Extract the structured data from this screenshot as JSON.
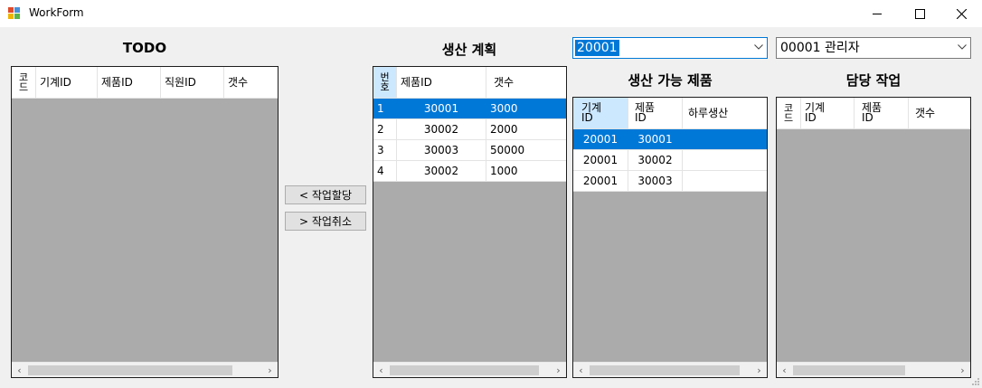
{
  "window": {
    "title": "WorkForm"
  },
  "todo": {
    "heading": "TODO",
    "columns": [
      "코\n드",
      "기계ID",
      "제품ID",
      "직원ID",
      "갯수"
    ]
  },
  "actions": {
    "assign_label": "< 작업할당",
    "cancel_label": "> 작업취소"
  },
  "plan": {
    "heading": "생산 계획",
    "columns": [
      "번\n호",
      "제품ID",
      "갯수"
    ],
    "rows": [
      [
        "1",
        "30001",
        "3000"
      ],
      [
        "2",
        "30002",
        "2000"
      ],
      [
        "3",
        "30003",
        "50000"
      ],
      [
        "4",
        "30002",
        "1000"
      ]
    ],
    "selected_row": 0
  },
  "machine_combo": {
    "value": "20001"
  },
  "staff_combo": {
    "value": "00001 관리자"
  },
  "products": {
    "heading": "생산 가능 제품",
    "columns": [
      "기계\nID",
      "제품\nID",
      "하루생산"
    ],
    "rows": [
      [
        "20001",
        "30001",
        ""
      ],
      [
        "20001",
        "30002",
        ""
      ],
      [
        "20001",
        "30003",
        ""
      ]
    ],
    "selected_row": 0
  },
  "assigned": {
    "heading": "담당 작업",
    "columns": [
      "코\n드",
      "기계\nID",
      "제품\nID",
      "갯수"
    ]
  },
  "colors": {
    "selection": "#0078d7",
    "grid_bg": "#ababab",
    "header_sel": "#cce8ff"
  }
}
